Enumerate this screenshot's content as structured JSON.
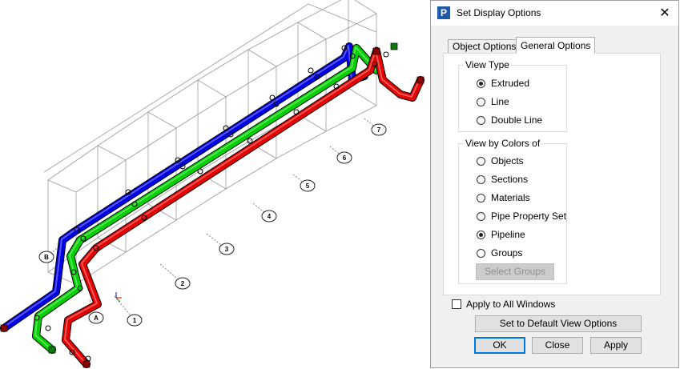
{
  "viewport": {
    "gridline_labels": [
      "1",
      "2",
      "3",
      "4",
      "5",
      "6",
      "7",
      "A",
      "B"
    ],
    "pipe_colors": [
      "#0000e6",
      "#00d200",
      "#e60000"
    ]
  },
  "dialog": {
    "title": "Set Display Options",
    "app_icon_letter": "P",
    "close_glyph": "✕",
    "tabs": [
      {
        "label": "Object Options",
        "active": false
      },
      {
        "label": "General Options",
        "active": true
      }
    ],
    "view_type": {
      "title": "View Type",
      "options": [
        {
          "label": "Extruded",
          "checked": true
        },
        {
          "label": "Line",
          "checked": false
        },
        {
          "label": "Double Line",
          "checked": false
        }
      ]
    },
    "view_by_colors": {
      "title": "View by Colors of",
      "options": [
        {
          "label": "Objects",
          "checked": false
        },
        {
          "label": "Sections",
          "checked": false
        },
        {
          "label": "Materials",
          "checked": false
        },
        {
          "label": "Pipe Property Set",
          "checked": false
        },
        {
          "label": "Pipeline",
          "checked": true
        },
        {
          "label": "Groups",
          "checked": false
        }
      ],
      "select_groups_label": "Select Groups"
    },
    "apply_all_windows": {
      "label": "Apply to All Windows",
      "checked": false
    },
    "default_button_label": "Set to Default View Options",
    "ok_label": "OK",
    "close_label": "Close",
    "apply_label": "Apply"
  }
}
